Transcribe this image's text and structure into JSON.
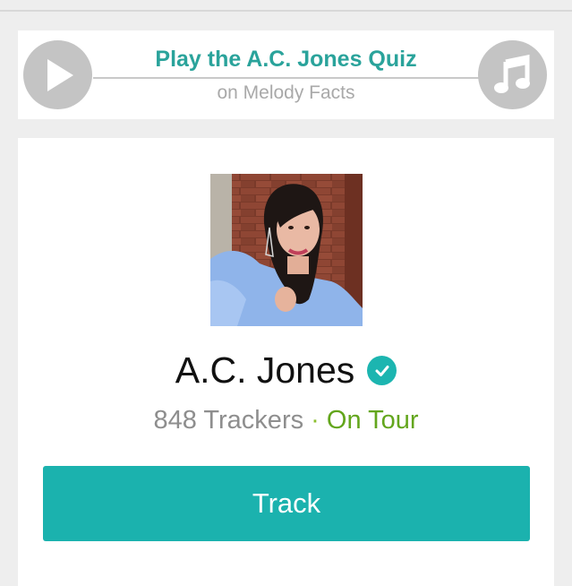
{
  "quiz_banner": {
    "title": "Play the A.C. Jones Quiz",
    "subtitle": "on Melody Facts",
    "left_icon": "play-icon",
    "right_icon": "music-note-icon"
  },
  "profile": {
    "name": "A.C. Jones",
    "verified_icon": "verified-check-icon",
    "tracker_count": "848 Trackers",
    "separator": "·",
    "status": "On Tour",
    "track_button_label": "Track"
  },
  "colors": {
    "accent": "#1bb2ae",
    "quiz_title": "#2aa39b",
    "status_green": "#63a61d",
    "icon_gray": "#c4c4c4"
  }
}
